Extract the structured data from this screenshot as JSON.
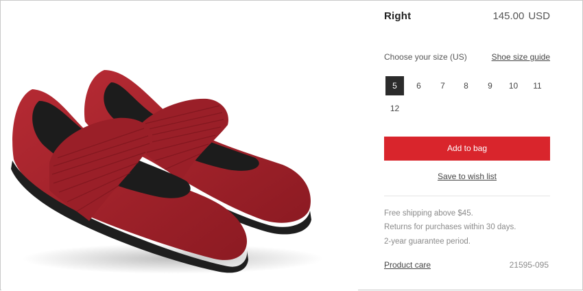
{
  "product": {
    "name": "Right",
    "price": "145.00",
    "currency": "USD",
    "sku": "21595-095",
    "color": "#a3242d"
  },
  "size_section": {
    "label": "Choose your size (US)",
    "guide_link": "Shoe size guide",
    "sizes": [
      "5",
      "6",
      "7",
      "8",
      "9",
      "10",
      "11",
      "12"
    ],
    "selected": "5"
  },
  "actions": {
    "add_to_bag": "Add to bag",
    "wishlist": "Save to wish list"
  },
  "info": {
    "shipping": "Free shipping above $45.",
    "returns": "Returns for purchases within 30 days.",
    "guarantee": "2-year guarantee period.",
    "care_link": "Product care"
  },
  "colors": {
    "accent": "#d9252c",
    "selected_size_bg": "#2b2b2b"
  }
}
